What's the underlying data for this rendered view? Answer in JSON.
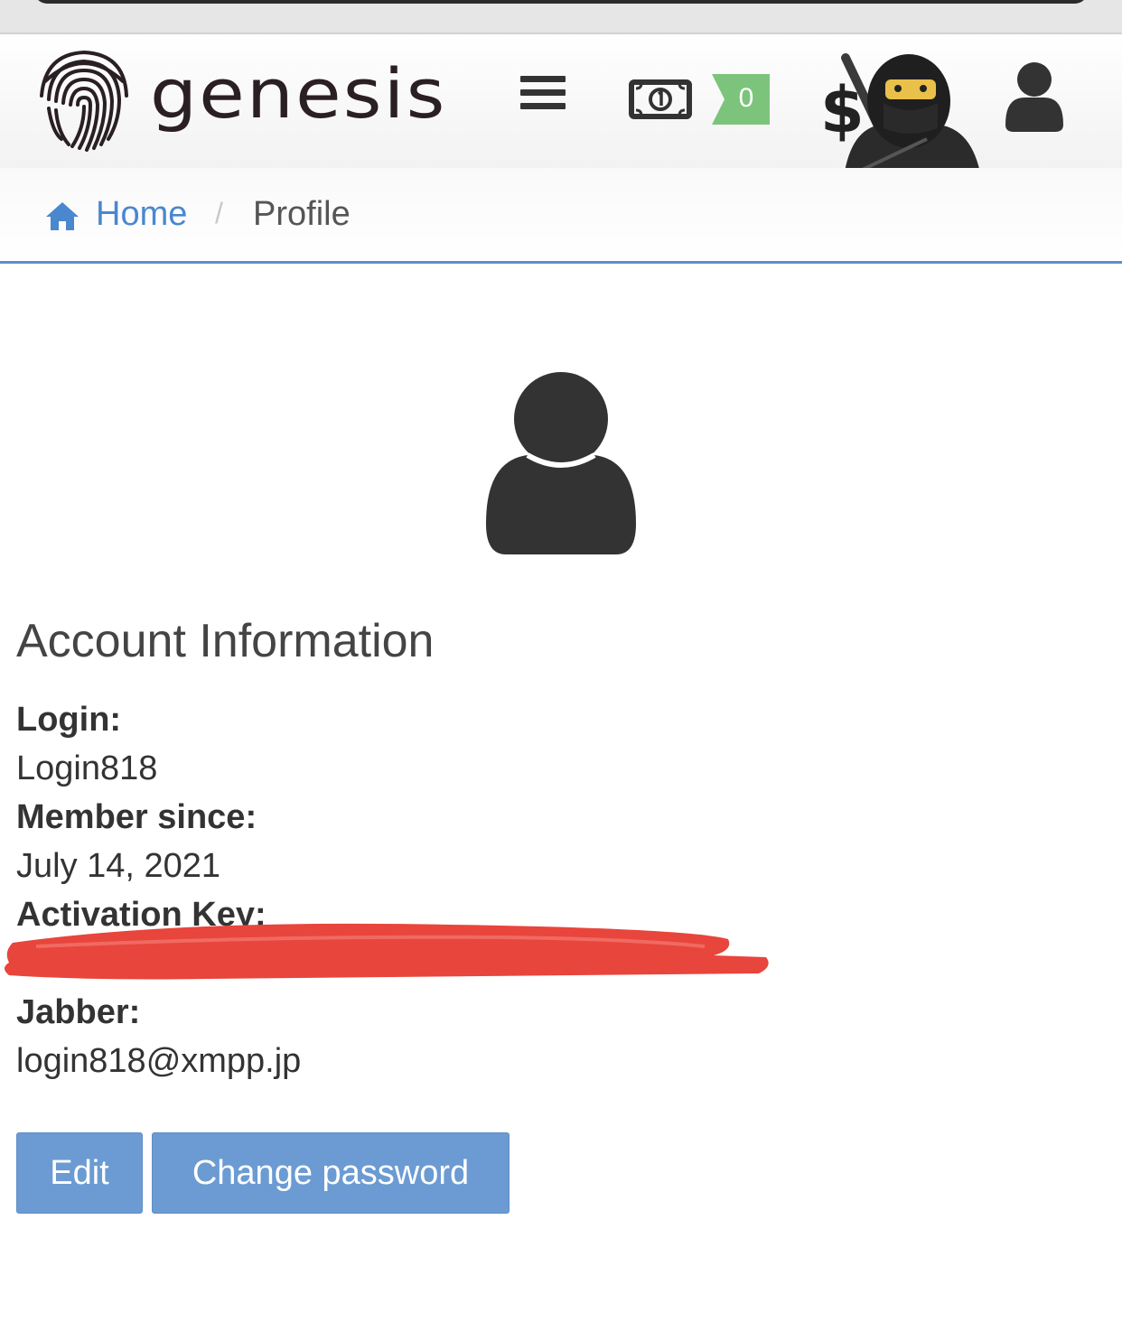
{
  "navbar": {
    "brand": "genesis",
    "balance": "0",
    "ninja_currency_symbol": "$",
    "icons": {
      "logo": "fingerprint-logo",
      "menu": "hamburger-menu-icon",
      "money": "banknote-icon",
      "balance": "balance-badge",
      "user": "user-icon"
    },
    "colors": {
      "brand_text": "#2a1f22",
      "balance_badge": "#7cc47c"
    }
  },
  "breadcrumb": {
    "home_label": "Home",
    "separator": "/",
    "current_label": "Profile",
    "link_color": "#4a87cf"
  },
  "profile": {
    "section_title": "Account Information",
    "fields": [
      {
        "label": "Login:",
        "value": "Login818"
      },
      {
        "label": "Member since:",
        "value": "July 14, 2021"
      },
      {
        "label": "Activation Key:",
        "value": ""
      },
      {
        "label": "Jabber:",
        "value": "login818@xmpp.jp"
      }
    ],
    "redaction_color": "#e8453c"
  },
  "actions": {
    "edit_label": "Edit",
    "change_password_label": "Change password",
    "button_color": "#6b9bd2"
  }
}
